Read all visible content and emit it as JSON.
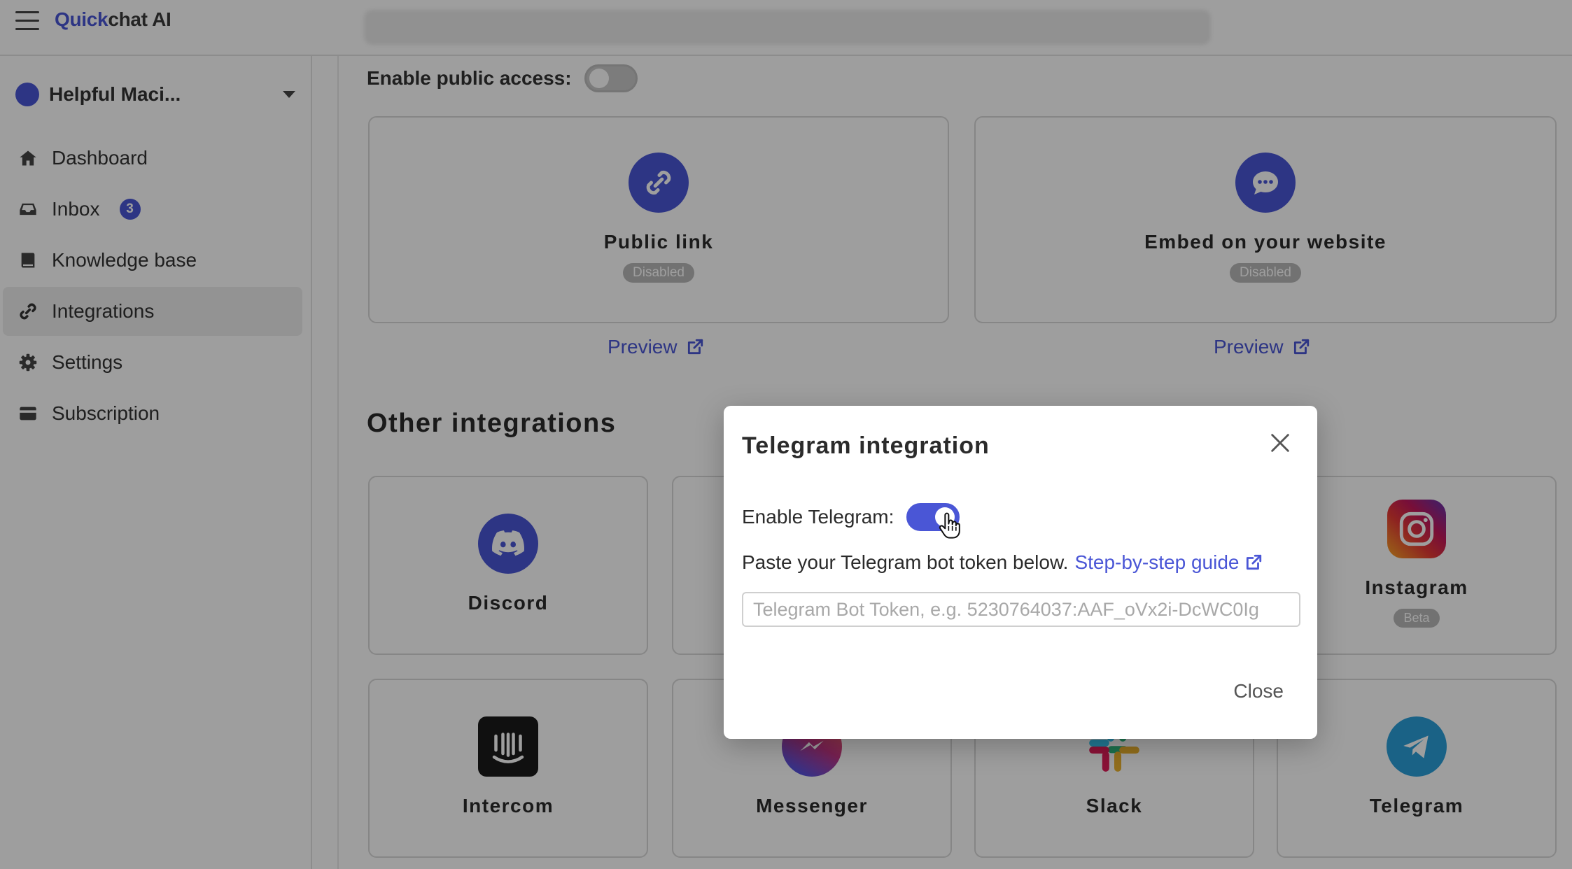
{
  "app": {
    "brand_part1": "Quick",
    "brand_part2": "chat AI"
  },
  "sidebar": {
    "bot_name": "Helpful Maci...",
    "items": [
      {
        "label": "Dashboard",
        "icon": "home-icon"
      },
      {
        "label": "Inbox",
        "icon": "inbox-icon",
        "badge": "3"
      },
      {
        "label": "Knowledge base",
        "icon": "book-icon"
      },
      {
        "label": "Integrations",
        "icon": "link-icon",
        "active": true
      },
      {
        "label": "Settings",
        "icon": "gear-icon"
      },
      {
        "label": "Subscription",
        "icon": "card-icon"
      }
    ]
  },
  "main": {
    "public_access_label": "Enable public access:",
    "public_access_enabled": false,
    "cards": [
      {
        "title": "Public link",
        "status": "Disabled",
        "icon": "link-icon"
      },
      {
        "title": "Embed on your website",
        "status": "Disabled",
        "icon": "chat-bubble-icon"
      }
    ],
    "preview_label": "Preview",
    "other_title": "Other integrations",
    "integrations": [
      {
        "title": "Discord",
        "icon": "discord-icon"
      },
      {
        "title": "Instagram",
        "icon": "instagram-icon",
        "tag": "Beta"
      },
      {
        "title": "Intercom",
        "icon": "intercom-icon"
      },
      {
        "title": "Messenger",
        "icon": "messenger-icon"
      },
      {
        "title": "Slack",
        "icon": "slack-icon"
      },
      {
        "title": "Telegram",
        "icon": "telegram-icon"
      }
    ]
  },
  "modal": {
    "title": "Telegram integration",
    "enable_label": "Enable Telegram:",
    "enabled": true,
    "instruction": "Paste your Telegram bot token below.",
    "guide_link": "Step-by-step guide",
    "token_placeholder": "Telegram Bot Token, e.g. 5230764037:AAF_oVx2i-DcWC0Ig",
    "token_value": "",
    "close_label": "Close"
  },
  "colors": {
    "accent": "#4a56d6",
    "telegram": "#2a9fd8",
    "pill": "#b9b9b9"
  }
}
